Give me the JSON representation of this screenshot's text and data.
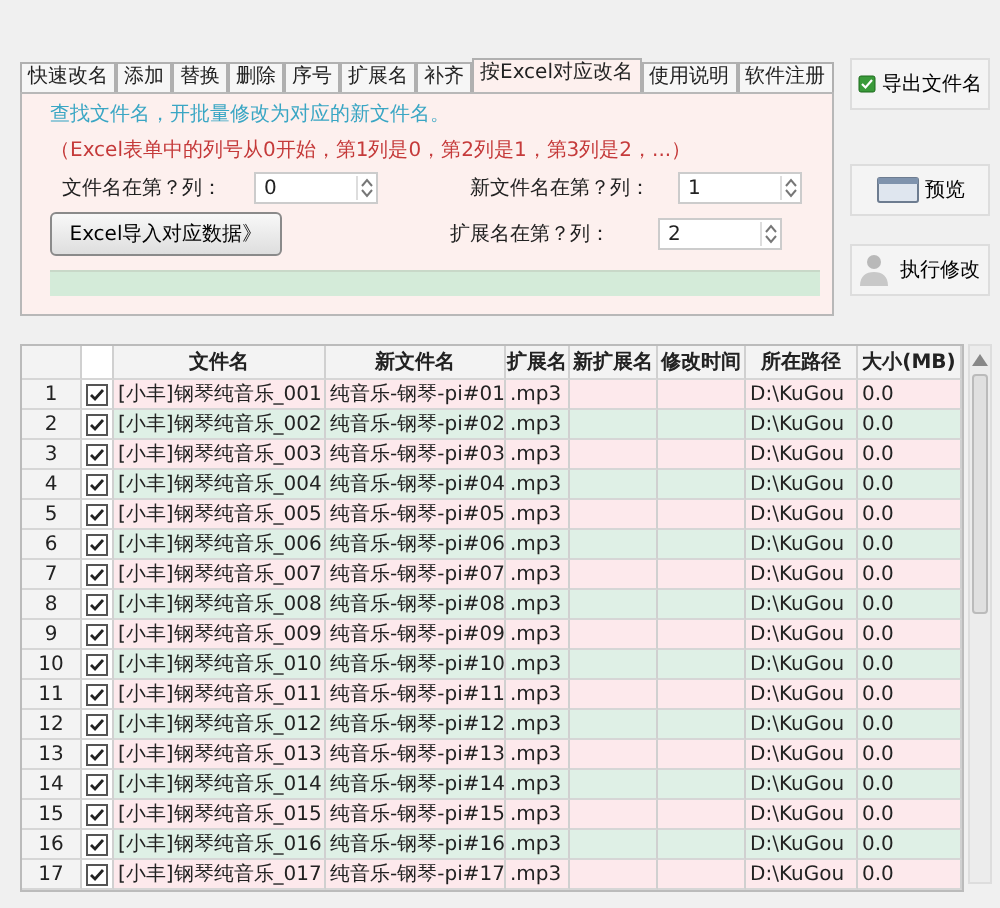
{
  "tabs": [
    {
      "label": "快速改名",
      "selected": false
    },
    {
      "label": "添加",
      "selected": false
    },
    {
      "label": "替换",
      "selected": false
    },
    {
      "label": "删除",
      "selected": false
    },
    {
      "label": "序号",
      "selected": false
    },
    {
      "label": "扩展名",
      "selected": false
    },
    {
      "label": "补齐",
      "selected": false
    },
    {
      "label": "按Excel对应改名",
      "selected": true
    },
    {
      "label": "使用说明",
      "selected": false
    },
    {
      "label": "软件注册",
      "selected": false
    }
  ],
  "panel": {
    "hint": "查找文件名，开批量修改为对应的新文件名。",
    "note": "（Excel表单中的列号从0开始，第1列是0，第2列是1，第3列是2，...）",
    "name_col": {
      "label": "文件名在第？列：",
      "value": "0"
    },
    "new_name_col": {
      "label": "新文件名在第？列：",
      "value": "1"
    },
    "import_button": "Excel导入对应数据》",
    "ext_col": {
      "label": "扩展名在第？列：",
      "value": "2"
    }
  },
  "side_buttons": [
    {
      "kind": "export",
      "label": "导出文件名"
    },
    {
      "kind": "preview",
      "label": "预览"
    },
    {
      "kind": "execute",
      "label": "执行修改"
    }
  ],
  "table": {
    "columns": [
      "文件名",
      "新文件名",
      "扩展名",
      "新扩展名",
      "修改时间",
      "所在路径",
      "大小(MB)"
    ],
    "rows": [
      {
        "no": "1",
        "checked": true,
        "name": "[小丰]钢琴纯音乐_001",
        "new_name": "纯音乐-钢琴-pi#01",
        "ext": ".mp3",
        "path": "D:\\KuGou",
        "size": "0.0"
      },
      {
        "no": "2",
        "checked": true,
        "name": "[小丰]钢琴纯音乐_002",
        "new_name": "纯音乐-钢琴-pi#02",
        "ext": ".mp3",
        "path": "D:\\KuGou",
        "size": "0.0"
      },
      {
        "no": "3",
        "checked": true,
        "name": "[小丰]钢琴纯音乐_003",
        "new_name": "纯音乐-钢琴-pi#03",
        "ext": ".mp3",
        "path": "D:\\KuGou",
        "size": "0.0"
      },
      {
        "no": "4",
        "checked": true,
        "name": "[小丰]钢琴纯音乐_004",
        "new_name": "纯音乐-钢琴-pi#04",
        "ext": ".mp3",
        "path": "D:\\KuGou",
        "size": "0.0"
      },
      {
        "no": "5",
        "checked": true,
        "name": "[小丰]钢琴纯音乐_005",
        "new_name": "纯音乐-钢琴-pi#05",
        "ext": ".mp3",
        "path": "D:\\KuGou",
        "size": "0.0"
      },
      {
        "no": "6",
        "checked": true,
        "name": "[小丰]钢琴纯音乐_006",
        "new_name": "纯音乐-钢琴-pi#06",
        "ext": ".mp3",
        "path": "D:\\KuGou",
        "size": "0.0"
      },
      {
        "no": "7",
        "checked": true,
        "name": "[小丰]钢琴纯音乐_007",
        "new_name": "纯音乐-钢琴-pi#07",
        "ext": ".mp3",
        "path": "D:\\KuGou",
        "size": "0.0"
      },
      {
        "no": "8",
        "checked": true,
        "name": "[小丰]钢琴纯音乐_008",
        "new_name": "纯音乐-钢琴-pi#08",
        "ext": ".mp3",
        "path": "D:\\KuGou",
        "size": "0.0"
      },
      {
        "no": "9",
        "checked": true,
        "name": "[小丰]钢琴纯音乐_009",
        "new_name": "纯音乐-钢琴-pi#09",
        "ext": ".mp3",
        "path": "D:\\KuGou",
        "size": "0.0"
      },
      {
        "no": "10",
        "checked": true,
        "name": "[小丰]钢琴纯音乐_010",
        "new_name": "纯音乐-钢琴-pi#10",
        "ext": ".mp3",
        "path": "D:\\KuGou",
        "size": "0.0"
      },
      {
        "no": "11",
        "checked": true,
        "name": "[小丰]钢琴纯音乐_011",
        "new_name": "纯音乐-钢琴-pi#11",
        "ext": ".mp3",
        "path": "D:\\KuGou",
        "size": "0.0"
      },
      {
        "no": "12",
        "checked": true,
        "name": "[小丰]钢琴纯音乐_012",
        "new_name": "纯音乐-钢琴-pi#12",
        "ext": ".mp3",
        "path": "D:\\KuGou",
        "size": "0.0"
      },
      {
        "no": "13",
        "checked": true,
        "name": "[小丰]钢琴纯音乐_013",
        "new_name": "纯音乐-钢琴-pi#13",
        "ext": ".mp3",
        "path": "D:\\KuGou",
        "size": "0.0"
      },
      {
        "no": "14",
        "checked": true,
        "name": "[小丰]钢琴纯音乐_014",
        "new_name": "纯音乐-钢琴-pi#14",
        "ext": ".mp3",
        "path": "D:\\KuGou",
        "size": "0.0"
      },
      {
        "no": "15",
        "checked": true,
        "name": "[小丰]钢琴纯音乐_015",
        "new_name": "纯音乐-钢琴-pi#15",
        "ext": ".mp3",
        "path": "D:\\KuGou",
        "size": "0.0"
      },
      {
        "no": "16",
        "checked": true,
        "name": "[小丰]钢琴纯音乐_016",
        "new_name": "纯音乐-钢琴-pi#16",
        "ext": ".mp3",
        "path": "D:\\KuGou",
        "size": "0.0"
      },
      {
        "no": "17",
        "checked": true,
        "name": "[小丰]钢琴纯音乐_017",
        "new_name": "纯音乐-钢琴-pi#17",
        "ext": ".mp3",
        "path": "D:\\KuGou",
        "size": "0.0"
      }
    ]
  }
}
